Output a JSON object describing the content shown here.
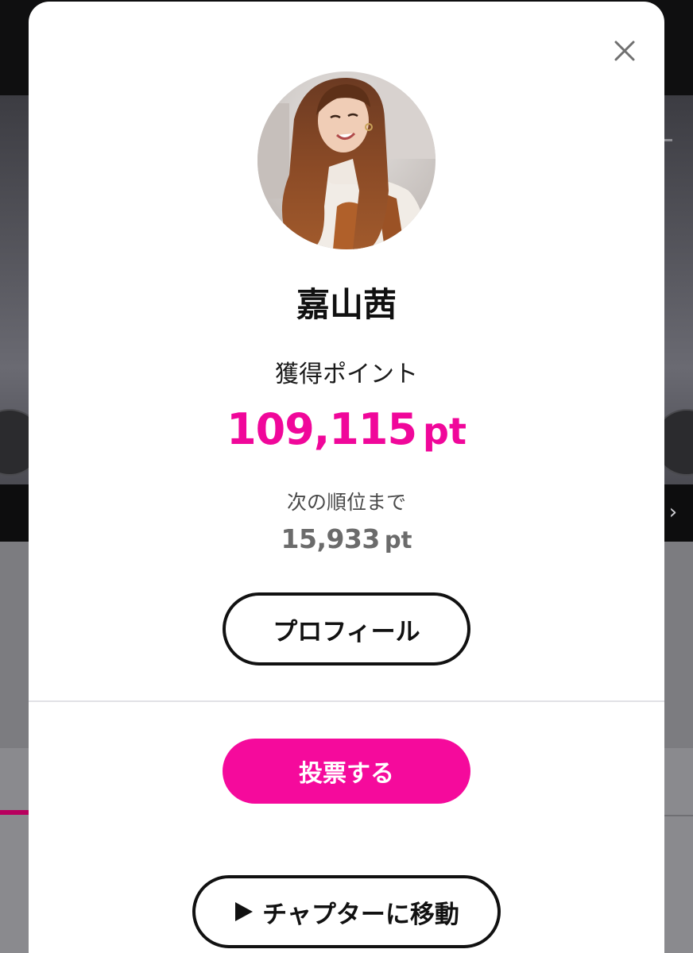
{
  "modal": {
    "performer_name": "嘉山茜",
    "points_label": "獲得ポイント",
    "points_value": "109,115",
    "points_unit": "pt",
    "next_rank_label": "次の順位まで",
    "next_rank_value": "15,933",
    "next_rank_unit": "pt",
    "profile_button": "プロフィール",
    "vote_button": "投票する",
    "chapter_button": "チャプターに移動",
    "close_icon": "close-icon",
    "play_icon": "play-icon"
  },
  "colors": {
    "accent_pink": "#f50a9c",
    "points_pink": "#f0079a",
    "text_dark": "#111111",
    "text_grey": "#6b6b6b"
  }
}
